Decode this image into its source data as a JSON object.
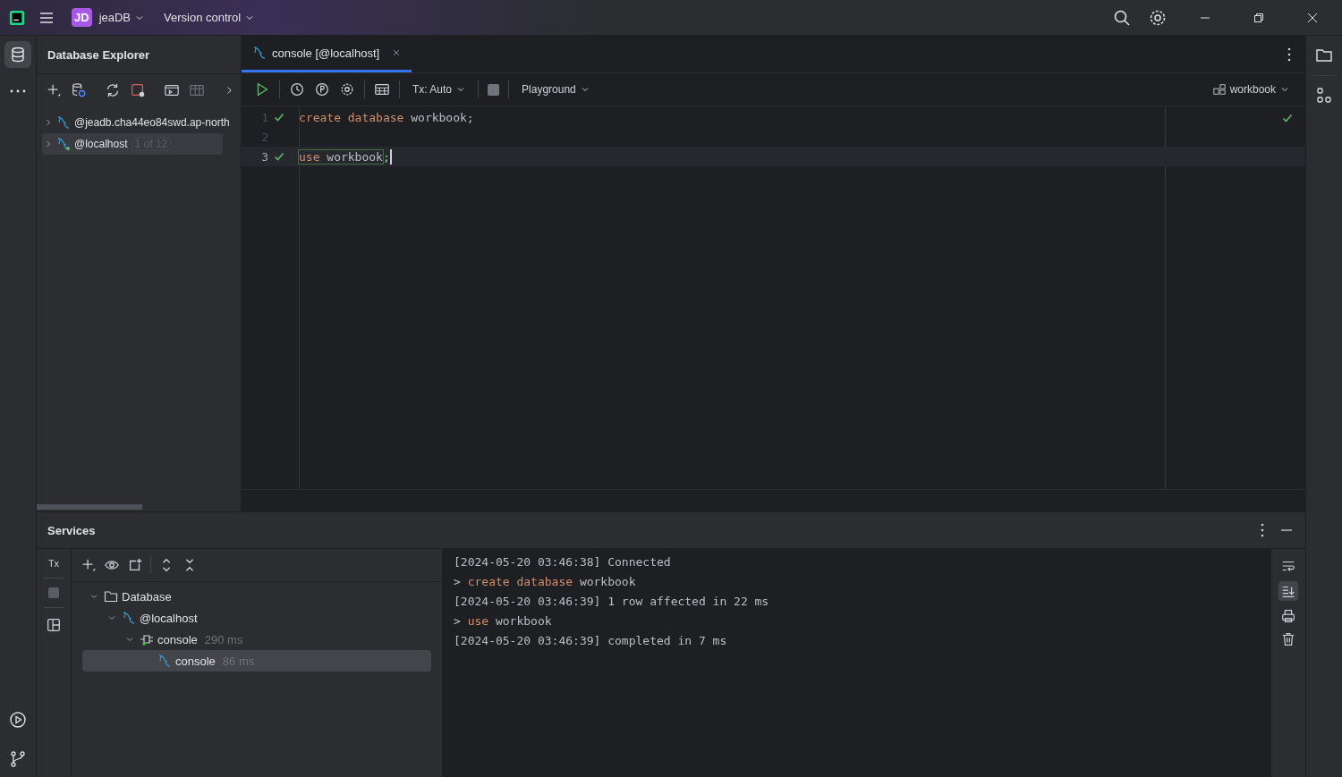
{
  "title_bar": {
    "project_badge": "JD",
    "project": "jeaDB",
    "vcs": "Version control"
  },
  "explorer": {
    "title": "Database Explorer",
    "items": [
      {
        "label": "@jeadb.cha44eo84swd.ap-north",
        "selected": false,
        "connected": false
      },
      {
        "label": "@localhost",
        "badge": "1 of 12",
        "selected": true,
        "connected": true
      }
    ]
  },
  "editor": {
    "tabs": [
      {
        "label": "console [@localhost]",
        "selected": true
      }
    ],
    "toolbar": {
      "tx": "Tx: Auto",
      "mode": "Playground",
      "schema": "workbook"
    },
    "file_ok": true,
    "lines": [
      {
        "number": "1",
        "ok": true,
        "current": false,
        "tokens": [
          {
            "text": "create database",
            "kind": "keyword"
          },
          {
            "text": " workbook;",
            "kind": "plain"
          }
        ]
      },
      {
        "number": "2",
        "ok": false,
        "current": false
      },
      {
        "number": "3",
        "ok": true,
        "current": true,
        "tokens": [
          {
            "text": "use",
            "kind": "keyword"
          },
          {
            "text": " workbook",
            "kind": "plain"
          },
          {
            "text": ";",
            "kind": "plain"
          }
        ]
      }
    ]
  },
  "services": {
    "title": "Services",
    "tx_button": "Tx",
    "tree": [
      {
        "label": "Database",
        "kind": "folder",
        "expanded": true,
        "selected": false,
        "children": [
          {
            "label": "@localhost",
            "kind": "datasource",
            "expanded": true,
            "selected": false,
            "children": [
              {
                "label": "console",
                "time": "290 ms",
                "kind": "session",
                "expanded": true,
                "selected": false,
                "children": [
                  {
                    "label": "console",
                    "time": "86 ms",
                    "kind": "console",
                    "selected": true
                  }
                ]
              }
            ]
          }
        ]
      }
    ],
    "log": [
      {
        "tokens": [
          {
            "text": "[2024-05-20 03:46:38] Connected",
            "kind": "plain"
          }
        ]
      },
      {
        "tokens": [
          {
            "text": "> ",
            "kind": "plain"
          },
          {
            "text": "create database",
            "kind": "keyword"
          },
          {
            "text": " workbook",
            "kind": "plain"
          }
        ]
      },
      {
        "tokens": [
          {
            "text": "[2024-05-20 03:46:39] 1 row affected in 22 ms",
            "kind": "plain"
          }
        ]
      },
      {
        "tokens": [
          {
            "text": "> ",
            "kind": "plain"
          },
          {
            "text": "use",
            "kind": "keyword"
          },
          {
            "text": " workbook",
            "kind": "plain"
          }
        ]
      },
      {
        "tokens": [
          {
            "text": "[2024-05-20 03:46:39] completed in 7 ms",
            "kind": "plain"
          }
        ]
      }
    ]
  }
}
